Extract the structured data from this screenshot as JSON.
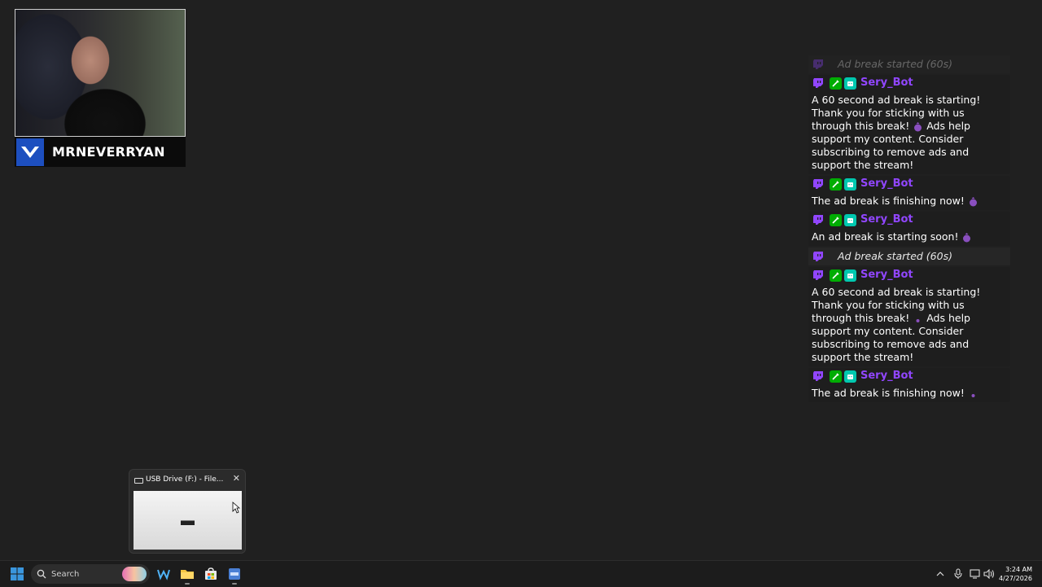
{
  "webcam": {
    "streamer_name": "MRNEVERRYAN"
  },
  "chat": {
    "faded_event": "Ad break started (60s)",
    "messages": [
      {
        "username": "Sery_Bot",
        "lines": "A 60 second ad break is starting! Thank you for sticking with us through this break! ",
        "lines_after": " Ads help support my content. Consider subscribing to remove ads and support the stream!"
      },
      {
        "username": "Sery_Bot",
        "text": "The ad break is finishing now! "
      },
      {
        "username": "Sery_Bot",
        "text": "An ad break is starting soon! "
      }
    ],
    "event": "Ad break started (60s)",
    "messages2": [
      {
        "username": "Sery_Bot",
        "lines": "A 60 second ad break is starting! Thank you for sticking with us through this break! ",
        "lines_after": " Ads help support my content. Consider subscribing to remove ads and support the stream!"
      },
      {
        "username": "Sery_Bot",
        "text": "The ad break is finishing now! "
      }
    ]
  },
  "thumbnail": {
    "title": "USB Drive (F:) - File..."
  },
  "taskbar": {
    "search_label": "Search",
    "time": "3:24 AM",
    "date": "4/27/2026"
  },
  "colors": {
    "username": "#9146ff",
    "mod_badge": "#00ad03",
    "vip_badge": "#00c8af",
    "start_blue": "#3a96dd"
  }
}
